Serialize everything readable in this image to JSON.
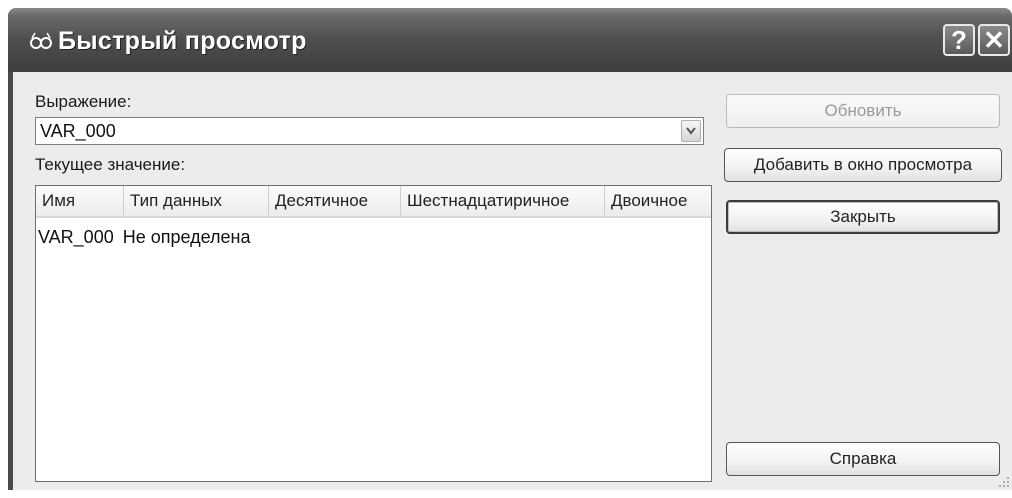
{
  "window": {
    "title": "Быстрый просмотр",
    "help_button": "?",
    "close_button": "✕"
  },
  "expression": {
    "label": "Выражение:",
    "value": "VAR_000"
  },
  "current_value": {
    "label": "Текущее значение:",
    "columns": [
      "Имя",
      "Тип данных",
      "Десятичное",
      "Шестнадцатиричное",
      "Двоичное"
    ],
    "rows": [
      {
        "name": "VAR_000",
        "type": "Не определена"
      }
    ]
  },
  "buttons": {
    "refresh": "Обновить",
    "add_to_watch": "Добавить в окно просмотра",
    "close": "Закрыть",
    "help": "Справка"
  }
}
